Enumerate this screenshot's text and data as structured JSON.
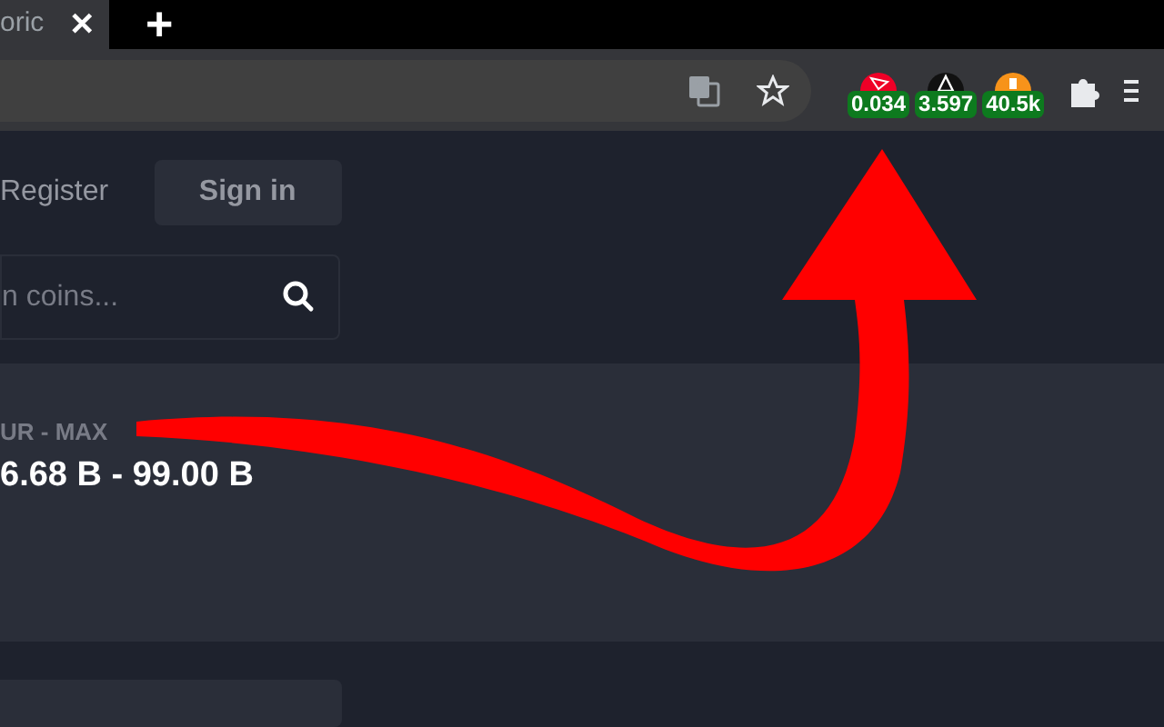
{
  "tab": {
    "title": "oric",
    "close": "✕"
  },
  "new_tab": "+",
  "extensions": [
    {
      "kind": "tron",
      "value": "0.034"
    },
    {
      "kind": "eth",
      "value": "3.597"
    },
    {
      "kind": "btc",
      "value": "40.5k"
    }
  ],
  "nav": {
    "register": "Register",
    "sign_in": "Sign in"
  },
  "search": {
    "placeholder": "n coins..."
  },
  "card": {
    "label": "UR - MAX",
    "value": "6.68 B - 99.00 B"
  }
}
